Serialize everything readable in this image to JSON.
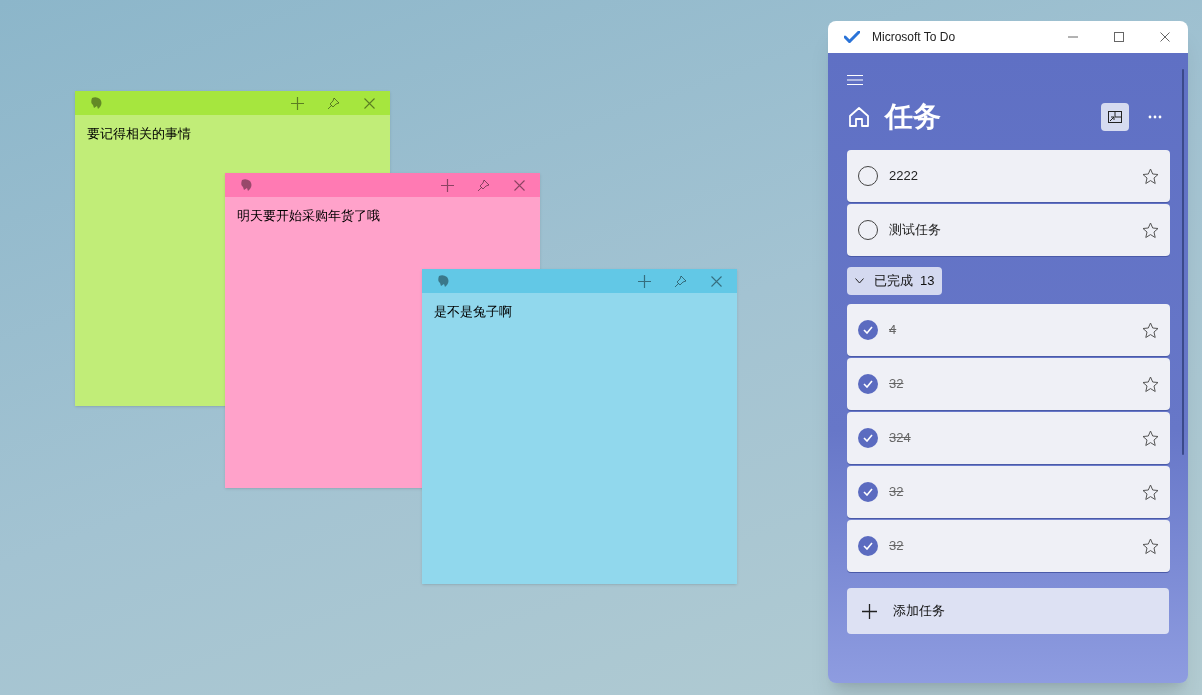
{
  "notes": [
    {
      "text": "要记得相关的事情",
      "color": "#a6e63e"
    },
    {
      "text": "明天要开始采购年货了哦",
      "color": "#ff7ab3"
    },
    {
      "text": "是不是兔子啊",
      "color": "#62c8e6"
    }
  ],
  "window": {
    "title": "Microsoft To Do"
  },
  "list_title": "任务",
  "tasks": [
    {
      "title": "2222",
      "completed": false,
      "starred": false
    },
    {
      "title": "测试任务",
      "completed": false,
      "starred": false
    }
  ],
  "completed_group": {
    "label": "已完成",
    "count": "13",
    "expanded": true
  },
  "completed_tasks": [
    {
      "title": "4",
      "completed": true,
      "starred": false
    },
    {
      "title": "32",
      "completed": true,
      "starred": false
    },
    {
      "title": "324",
      "completed": true,
      "starred": false
    },
    {
      "title": "32",
      "completed": true,
      "starred": false
    },
    {
      "title": "32",
      "completed": true,
      "starred": false
    }
  ],
  "add_task": {
    "label": "添加任务"
  }
}
